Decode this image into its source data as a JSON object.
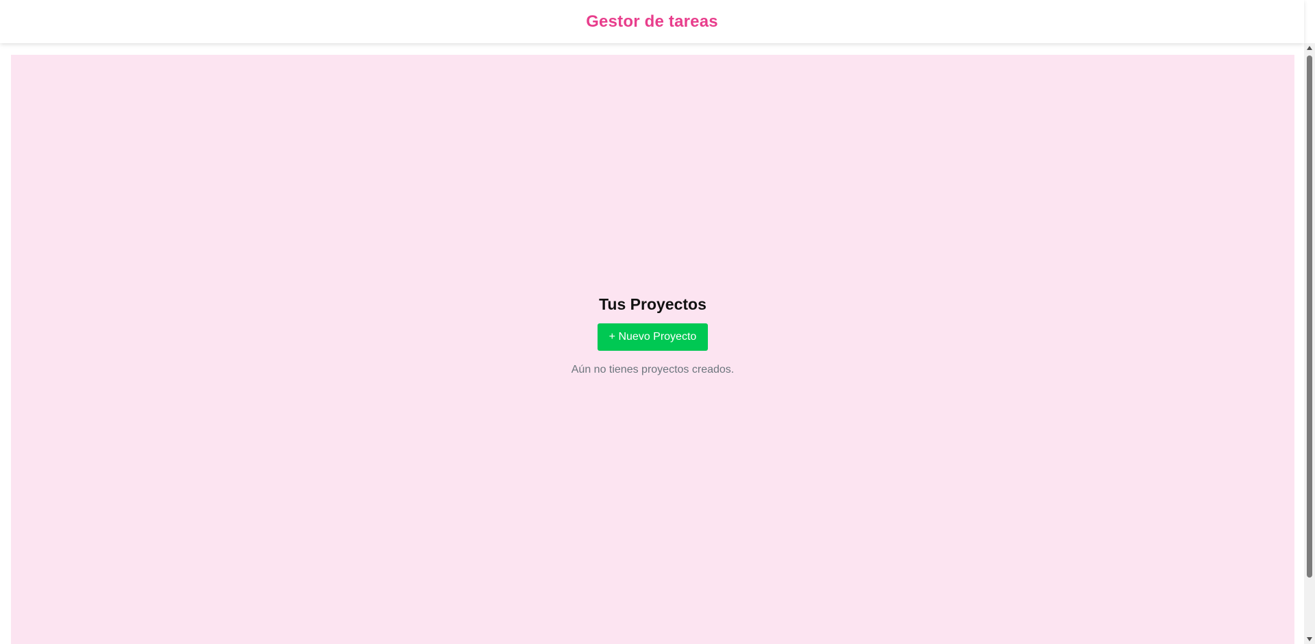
{
  "header": {
    "title": "Gestor de tareas"
  },
  "main": {
    "section_title": "Tus Proyectos",
    "new_project_label": "+ Nuevo Proyecto",
    "empty_state_text": "Aún no tienes proyectos creados."
  },
  "colors": {
    "brand": "#e83e8c",
    "content_background": "#fce4f1",
    "primary_button": "#00c853",
    "muted_text": "#6c757d",
    "scrollbar_track": "#f1f1f1",
    "scrollbar_thumb": "#7b7b7b"
  },
  "icons": {
    "scroll_up": "triangle-up-icon",
    "scroll_down": "triangle-down-icon"
  }
}
